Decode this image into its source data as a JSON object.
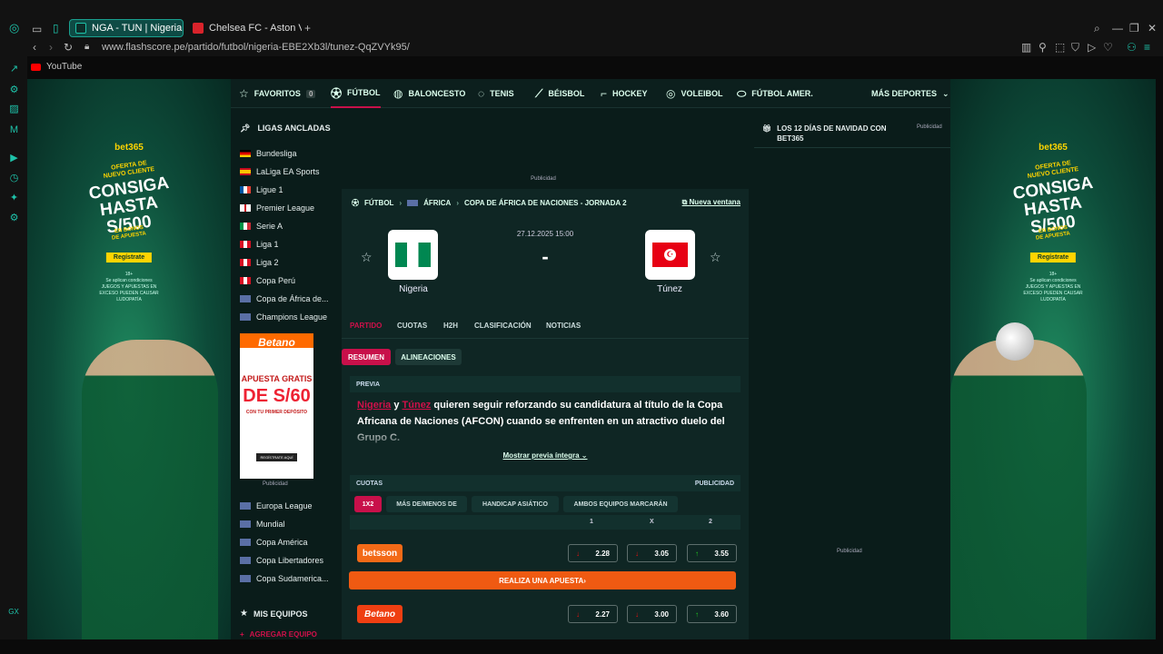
{
  "browser": {
    "tabs": [
      {
        "label": "NGA - TUN | Nigeria vs Tú",
        "active": true
      },
      {
        "label": "Chelsea FC - Aston Villa F",
        "active": false
      }
    ],
    "url_domain": "www.flashscore.pe",
    "url_path": "/partido/futbol/nigeria-EBE2Xb3l/tunez-QqZVYk95/",
    "bookmark": "YouTube",
    "rail_label": "GX"
  },
  "promo": {
    "brand_prefix": "bet",
    "brand_suffix": "365",
    "line1": "OFERTA DE",
    "line2": "NUEVO CLIENTE",
    "line3": "CONSIGA",
    "line4": "HASTA",
    "line5": "S/500",
    "line6": "EN BONOS",
    "line7": "DE APUESTA",
    "button": "Regístrate",
    "fine1": "18+",
    "fine2": "Se aplican condiciones",
    "fine3": "JUEGOS Y APUESTAS EN",
    "fine4": "EXCESO PUEDEN CAUSAR",
    "fine5": "LUDOPATÍA"
  },
  "sportnav": {
    "favoritos": "FAVORITOS",
    "favoritos_count": "0",
    "items": [
      "FÚTBOL",
      "BALONCESTO",
      "TENIS",
      "BÉISBOL",
      "HOCKEY",
      "VOLEIBOL",
      "FÚTBOL AMER."
    ],
    "more": "MÁS DEPORTES"
  },
  "leagues": {
    "heading": "LIGAS ANCLADAS",
    "items": [
      "Bundesliga",
      "LaLiga EA Sports",
      "Ligue 1",
      "Premier League",
      "Serie A",
      "Liga 1",
      "Liga 2",
      "Copa Perú",
      "Copa de África de...",
      "Champions League"
    ],
    "items2": [
      "Europa League",
      "Mundial",
      "Copa América",
      "Copa Libertadores",
      "Copa Sudamerica..."
    ],
    "ad_label": "Publicidad",
    "ad_brand": "Betano",
    "ad_line1": "APUESTA GRATIS",
    "ad_line2": "DE S/60",
    "ad_line3": "CON TU PRIMER DEPÓSITO",
    "ad_button": "REGÍSTRATE AQUÍ",
    "mis_equipos": "MIS EQUIPOS",
    "agregar": "AGREGAR EQUIPO"
  },
  "main": {
    "ad_label": "Publicidad",
    "breadcrumb": [
      "FÚTBOL",
      "ÁFRICA",
      "COPA DE ÁFRICA DE NACIONES - JORNADA 2"
    ],
    "nueva_ventana": "Nueva ventana",
    "date": "27.12.2025 15:00",
    "score": "-",
    "home": "Nigeria",
    "away": "Túnez",
    "tabs": [
      "PARTIDO",
      "CUOTAS",
      "H2H",
      "CLASIFICACIÓN",
      "NOTICIAS"
    ],
    "subtabs": [
      "RESUMEN",
      "ALINEACIONES"
    ],
    "previa_label": "PREVIA",
    "previa_link1": "Nigeria",
    "previa_and": " y ",
    "previa_link2": "Túnez",
    "previa_text": " quieren seguir reforzando su candidatura al título de la Copa Africana de Naciones (AFCON) cuando se enfrenten en un atractivo duelo del Grupo C.",
    "mostrar": "Mostrar previa íntegra",
    "cuotas_label": "CUOTAS",
    "cuotas_pub": "PUBLICIDAD",
    "odds_tabs": [
      "1X2",
      "MÁS DE/MENOS DE",
      "HANDICAP ASIÁTICO",
      "AMBOS EQUIPOS MARCARÁN"
    ],
    "odds_headers": [
      "1",
      "X",
      "2"
    ],
    "bookies": [
      {
        "name": "betsson",
        "odds": [
          "2.28",
          "3.05",
          "3.55"
        ]
      },
      {
        "name": "Betano",
        "odds": [
          "2.27",
          "3.00",
          "3.60"
        ]
      }
    ],
    "cta": "REALIZA UNA APUESTA"
  },
  "right": {
    "title": "LOS 12 DÍAS DE NAVIDAD CON BET365",
    "pub": "Publicidad",
    "pub2": "Publicidad"
  },
  "colors": {
    "accent": "#c8104a",
    "teal": "#1ec2a9",
    "cta": "#ef5a12",
    "bg": "#0a1c1a"
  }
}
